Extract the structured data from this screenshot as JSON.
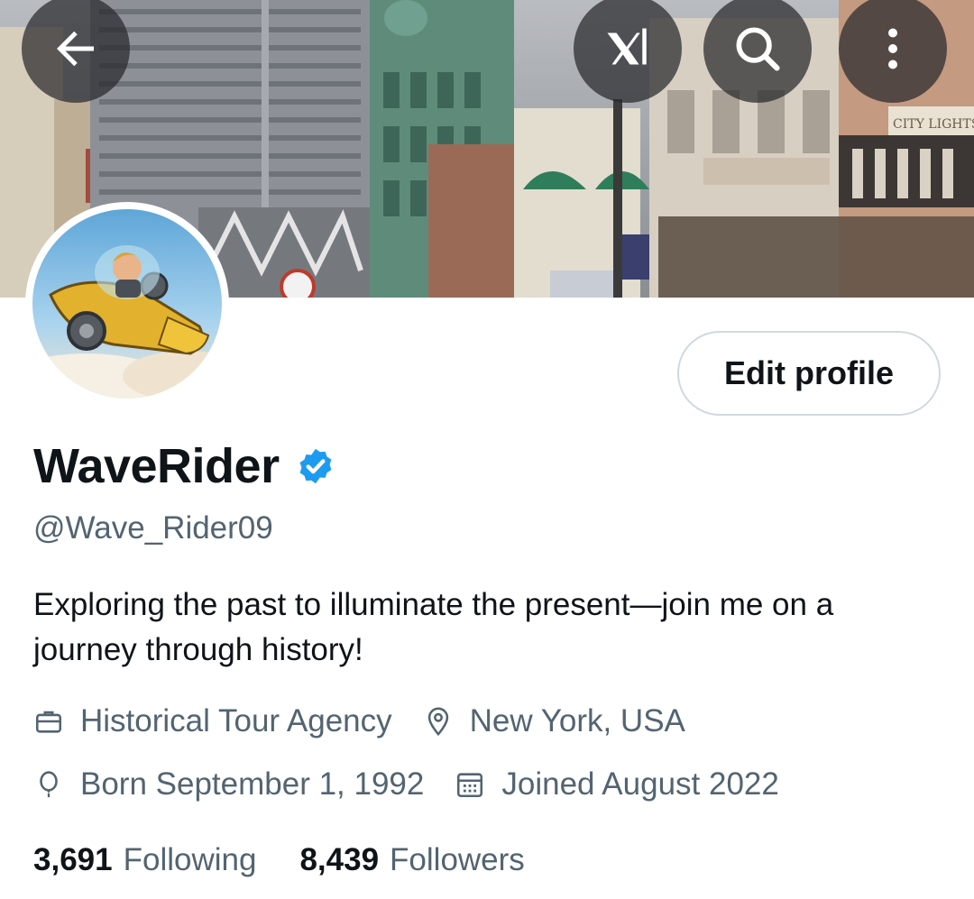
{
  "header": {
    "back_icon": "arrow-left-icon",
    "grok_icon": "xai-grok-icon",
    "search_icon": "search-icon",
    "more_icon": "more-vertical-icon",
    "banner_sign_text": "CITY LIGHTS Books"
  },
  "profile": {
    "edit_label": "Edit profile",
    "name": "WaveRider",
    "verified": true,
    "handle": "@Wave_Rider09",
    "bio": "Exploring the past to illuminate the present—join me on a journey through history!",
    "category": "Historical Tour Agency",
    "location": "New York, USA",
    "born": "Born September 1, 1992",
    "joined": "Joined August 2022"
  },
  "stats": {
    "following_count": "3,691",
    "following_label": "Following",
    "followers_count": "8,439",
    "followers_label": "Followers"
  },
  "colors": {
    "verified": "#1d9bf0",
    "secondary_text": "#536471",
    "primary_text": "#0f1419",
    "border": "#cfd9de"
  }
}
